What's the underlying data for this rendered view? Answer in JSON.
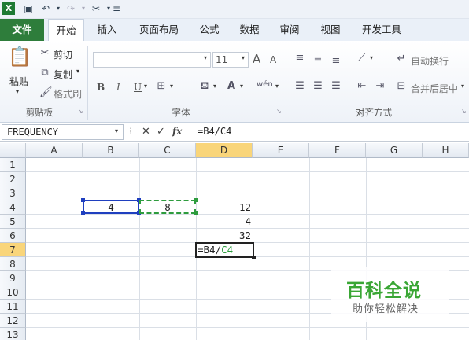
{
  "ribbon_tabs": [
    "文件",
    "开始",
    "插入",
    "页面布局",
    "公式",
    "数据",
    "审阅",
    "视图",
    "开发工具"
  ],
  "clipboard": {
    "paste": "粘贴",
    "cut": "剪切",
    "copy": "复制",
    "format_painter": "格式刷",
    "group": "剪贴板"
  },
  "font": {
    "size": "11",
    "group": "字体",
    "bold": "B",
    "italic": "I",
    "underline": "U",
    "grow": "A",
    "shrink": "A"
  },
  "alignment": {
    "wrap": "自动换行",
    "merge": "合并后居中",
    "group": "对齐方式"
  },
  "formula_bar": {
    "name_box": "FREQUENCY",
    "cancel": "✕",
    "enter": "✓",
    "fx": "fx",
    "formula": "=B4/C4"
  },
  "columns": [
    "A",
    "B",
    "C",
    "D",
    "E",
    "F",
    "G",
    "H"
  ],
  "rows": [
    "1",
    "2",
    "3",
    "4",
    "5",
    "6",
    "7",
    "8",
    "9",
    "10",
    "11",
    "12",
    "13"
  ],
  "cells": {
    "B4": "4",
    "C4": "8",
    "D4": "12",
    "D5": "-4",
    "D6": "32",
    "D7_prefix": "=B4/",
    "D7_ref": "C4"
  },
  "watermark": {
    "title": "百科全说",
    "subtitle": "助你轻松解决"
  },
  "colors": {
    "file_tab": "#2e7d3b",
    "selected_col": "#f9d57a",
    "ref_blue": "#1f3fbf",
    "ref_green": "#2e9c3e"
  }
}
